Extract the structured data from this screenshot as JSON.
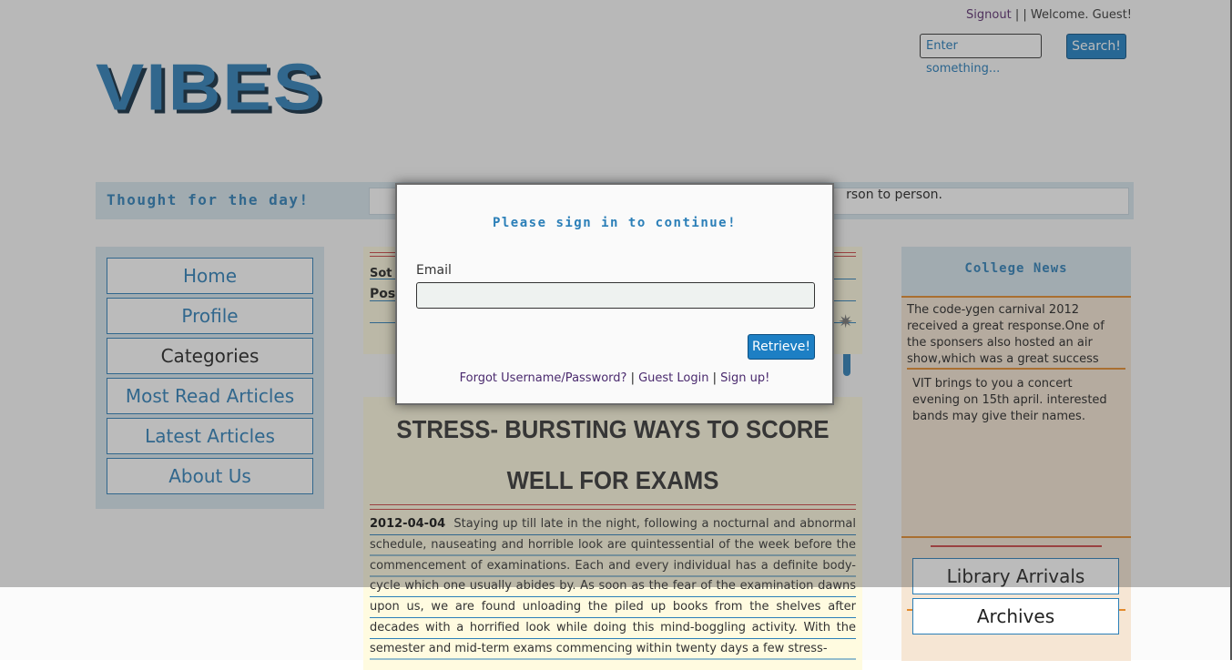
{
  "header": {
    "signout_label": "Signout",
    "separator": " | | ",
    "welcome_text": "Welcome. Guest!",
    "search_placeholder": "Enter something...",
    "search_button": "Search!",
    "logo_text": "VIBES"
  },
  "thought": {
    "label": "Thought for the day!",
    "text": "rson to person."
  },
  "nav": {
    "items": [
      {
        "label": "Home"
      },
      {
        "label": "Profile"
      },
      {
        "label": "Categories"
      },
      {
        "label": "Most Read Articles"
      },
      {
        "label": "Latest Articles"
      },
      {
        "label": "About Us"
      }
    ]
  },
  "mini_post": {
    "sot": "Sot",
    "post": "Post"
  },
  "article": {
    "title": "STRESS- BURSTING WAYS TO SCORE WELL FOR EXAMS",
    "date": "2012-04-04",
    "body": "Staying up till late in the night, following a nocturnal and abnormal schedule, nauseating and horrible look are quintessential of the week before the commencement of examinations. Each and every individual has a definite body-cycle which one usually abides by. As soon as the fear of the examination dawns upon us, we are found unloading the piled up books from the shelves after decades with a horrified look while doing this mind-boggling activity. With the semester and mid-term exams commencing within twenty days a few stress-"
  },
  "college_news": {
    "heading": "College News",
    "items": [
      "The code-ygen carnival 2012 received a great response.One of the sponsers also hosted an air show,which was a great success",
      "VIT brings to you a concert evening on 15th april. interested bands may give their names."
    ]
  },
  "right_buttons": {
    "library": "Library Arrivals",
    "archives": "Archives"
  },
  "modal": {
    "title": "Please sign in to continue!",
    "email_label": "Email",
    "email_value": "",
    "retrieve_button": "Retrieve!",
    "forgot_link": "Forgot Username/Password?",
    "sep": " | ",
    "guest_link": "Guest Login",
    "signup_link": "Sign up!"
  }
}
